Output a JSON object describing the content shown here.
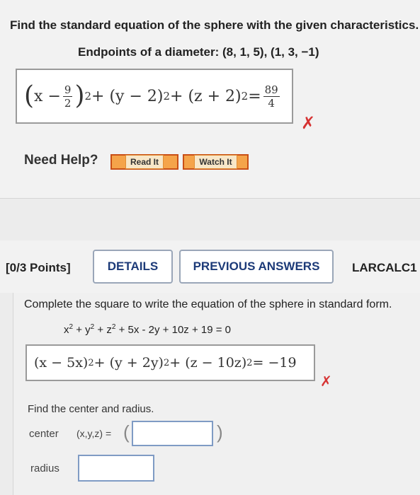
{
  "q1": {
    "prompt": "Find the standard equation of the sphere with the given characteristics.",
    "characteristic": "Endpoints of a diameter: (8, 1, 5), (1, 3, −1)",
    "answer": {
      "open_paren": "(",
      "x_part": "x −",
      "frac_num": "9",
      "frac_den": "2",
      "close_paren": ")",
      "sq1": "2",
      "rest": " + (y − 2)",
      "sq2": "2",
      "rest2": " + (z + 2)",
      "sq3": "2",
      "eq": " = ",
      "rhs_num": "89",
      "rhs_den": "4"
    },
    "status": "✗",
    "need_help": "Need Help?",
    "read_it": "Read It",
    "watch_it": "Watch It"
  },
  "q2": {
    "points": "[0/3 Points]",
    "details_label": "DETAILS",
    "prev_answers_label": "PREVIOUS ANSWERS",
    "course_code": "LARCALC1",
    "prompt": "Complete the square to write the equation of the sphere in standard form.",
    "equation": {
      "a": "x",
      "a_sq": "2",
      "b": " + y",
      "b_sq": "2",
      "c": " + z",
      "c_sq": "2",
      "d": " + 5x - 2y + 10z + 19 = 0"
    },
    "answer": {
      "p1": "(x − 5x)",
      "s1": "2",
      "p2": " + (y + 2y)",
      "s2": "2",
      "p3": " + (z − 10z)",
      "s3": "2",
      "p4": " = −19"
    },
    "status": "✗",
    "find_prompt": "Find the center and radius.",
    "center_label": "center",
    "center_coords": "(x,y,z) =",
    "open_paren": "(",
    "close_paren": ")",
    "center_value": "",
    "radius_label": "radius",
    "radius_value": ""
  },
  "colors": {
    "error": "#d63333",
    "link_text": "#1c3a78",
    "help_button": "#f5a44a",
    "input_border": "#7f9bc4"
  }
}
